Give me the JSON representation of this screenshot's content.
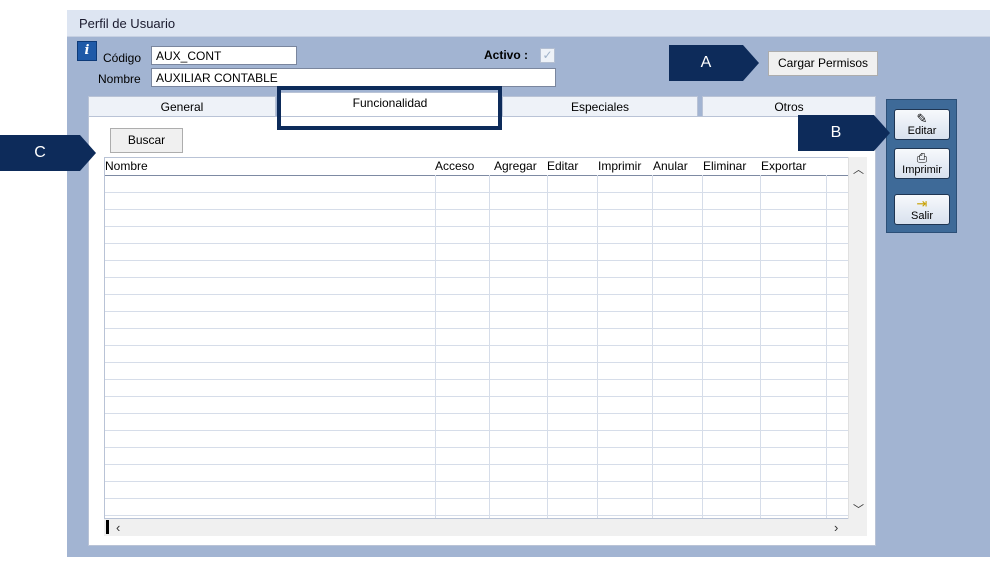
{
  "window": {
    "title": "Perfil de Usuario"
  },
  "form": {
    "codigo_label": "Código",
    "codigo_value": "AUX_CONT",
    "nombre_label": "Nombre",
    "nombre_value": "AUXILIAR CONTABLE",
    "activo_label": "Activo :",
    "activo_checked": true
  },
  "buttons": {
    "cargar_permisos": "Cargar Permisos",
    "buscar": "Buscar"
  },
  "tabs": [
    {
      "label": "General",
      "active": false
    },
    {
      "label": "Funcionalidad",
      "active": true
    },
    {
      "label": "Especiales",
      "active": false
    },
    {
      "label": "Otros",
      "active": false
    }
  ],
  "grid": {
    "columns": [
      "Nombre",
      "Acceso",
      "Agregar",
      "Editar",
      "Imprimir",
      "Anular",
      "Eliminar",
      "Exportar"
    ],
    "rows": []
  },
  "toolbar": {
    "editar": "Editar",
    "imprimir": "Imprimir",
    "salir": "Salir"
  },
  "callouts": {
    "a": "A",
    "b": "B",
    "c": "C"
  },
  "icons": {
    "info": "info-icon",
    "check": "checkmark-icon",
    "edit": "edit-icon",
    "print": "printer-icon",
    "exit": "exit-door-icon",
    "scroll_up": "chevron-up-icon",
    "scroll_down": "chevron-down-icon",
    "scroll_left": "chevron-left-icon",
    "scroll_right": "chevron-right-icon"
  },
  "colors": {
    "window_bg": "#a2b4d2",
    "toolbar_bg": "#3e6a98",
    "callout_bg": "#0d2b5a"
  }
}
